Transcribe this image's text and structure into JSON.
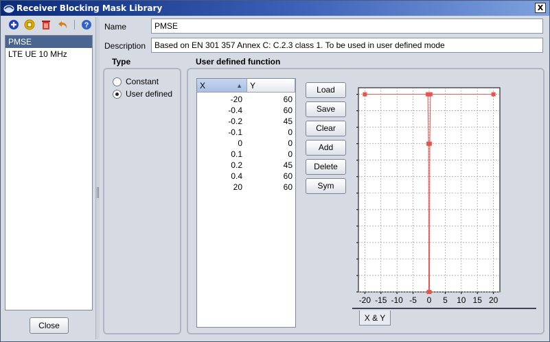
{
  "window": {
    "title": "Receiver Blocking Mask Library",
    "close_glyph": "X"
  },
  "toolbar": [
    {
      "name": "add-icon",
      "color": "#1d3fbe"
    },
    {
      "name": "duplicate-icon",
      "color": "#e2b400"
    },
    {
      "name": "delete-icon",
      "color": "#d83a2a"
    },
    {
      "name": "undo-icon",
      "color": "#e07a10"
    },
    {
      "name": "help-icon",
      "color": "#2e62c8"
    }
  ],
  "library": {
    "items": [
      {
        "label": "PMSE",
        "selected": true
      },
      {
        "label": "LTE UE 10 MHz",
        "selected": false
      }
    ],
    "close_label": "Close"
  },
  "form": {
    "name_label": "Name",
    "name_value": "PMSE",
    "description_label": "Description",
    "description_value": "Based on EN 301 357 Annex C: C.2.3 class 1. To be used in user defined mode"
  },
  "type": {
    "title": "Type",
    "options": [
      {
        "label": "Constant",
        "checked": false
      },
      {
        "label": "User defined",
        "checked": true
      }
    ]
  },
  "function": {
    "title": "User defined function",
    "columns": {
      "x": "X",
      "y": "Y",
      "sort_glyph": "▲"
    },
    "rows": [
      {
        "x": "-20",
        "y": "60"
      },
      {
        "x": "-0.4",
        "y": "60"
      },
      {
        "x": "-0.2",
        "y": "45"
      },
      {
        "x": "-0.1",
        "y": "0"
      },
      {
        "x": "0",
        "y": "0"
      },
      {
        "x": "0.1",
        "y": "0"
      },
      {
        "x": "0.2",
        "y": "45"
      },
      {
        "x": "0.4",
        "y": "60"
      },
      {
        "x": "20",
        "y": "60"
      }
    ],
    "buttons": {
      "load": "Load",
      "save": "Save",
      "clear": "Clear",
      "add": "Add",
      "delete": "Delete",
      "sym": "Sym"
    },
    "tab_label": "X & Y"
  },
  "chart_data": {
    "type": "line",
    "series": [
      {
        "x": [
          -20,
          -0.4,
          -0.2,
          -0.1,
          0,
          0.1,
          0.2,
          0.4,
          20
        ],
        "y": [
          60,
          60,
          45,
          0,
          0,
          0,
          45,
          60,
          60
        ]
      }
    ],
    "xlabel": "X",
    "ylabel": "Y",
    "xlim": [
      -22,
      22
    ],
    "ylim": [
      0,
      62
    ],
    "x_ticks": [
      -20,
      -15,
      -10,
      -5,
      0,
      5,
      10,
      15,
      20
    ],
    "y_ticks": [
      0,
      5,
      10,
      15,
      20,
      25,
      30,
      35,
      40,
      45,
      50,
      55,
      60
    ],
    "grid": true,
    "line_color": "#e8534f"
  }
}
